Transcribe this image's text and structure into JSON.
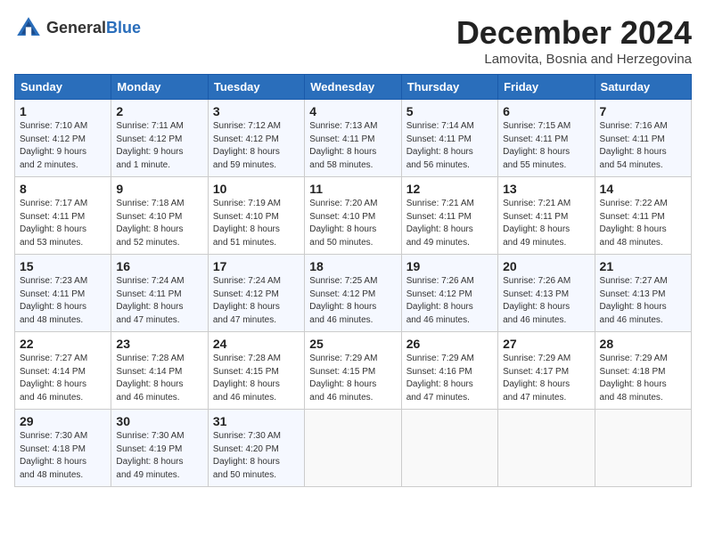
{
  "header": {
    "logo_general": "General",
    "logo_blue": "Blue",
    "title": "December 2024",
    "subtitle": "Lamovita, Bosnia and Herzegovina"
  },
  "columns": [
    "Sunday",
    "Monday",
    "Tuesday",
    "Wednesday",
    "Thursday",
    "Friday",
    "Saturday"
  ],
  "rows": [
    [
      {
        "day": "1",
        "lines": [
          "Sunrise: 7:10 AM",
          "Sunset: 4:12 PM",
          "Daylight: 9 hours",
          "and 2 minutes."
        ]
      },
      {
        "day": "2",
        "lines": [
          "Sunrise: 7:11 AM",
          "Sunset: 4:12 PM",
          "Daylight: 9 hours",
          "and 1 minute."
        ]
      },
      {
        "day": "3",
        "lines": [
          "Sunrise: 7:12 AM",
          "Sunset: 4:12 PM",
          "Daylight: 8 hours",
          "and 59 minutes."
        ]
      },
      {
        "day": "4",
        "lines": [
          "Sunrise: 7:13 AM",
          "Sunset: 4:11 PM",
          "Daylight: 8 hours",
          "and 58 minutes."
        ]
      },
      {
        "day": "5",
        "lines": [
          "Sunrise: 7:14 AM",
          "Sunset: 4:11 PM",
          "Daylight: 8 hours",
          "and 56 minutes."
        ]
      },
      {
        "day": "6",
        "lines": [
          "Sunrise: 7:15 AM",
          "Sunset: 4:11 PM",
          "Daylight: 8 hours",
          "and 55 minutes."
        ]
      },
      {
        "day": "7",
        "lines": [
          "Sunrise: 7:16 AM",
          "Sunset: 4:11 PM",
          "Daylight: 8 hours",
          "and 54 minutes."
        ]
      }
    ],
    [
      {
        "day": "8",
        "lines": [
          "Sunrise: 7:17 AM",
          "Sunset: 4:11 PM",
          "Daylight: 8 hours",
          "and 53 minutes."
        ]
      },
      {
        "day": "9",
        "lines": [
          "Sunrise: 7:18 AM",
          "Sunset: 4:10 PM",
          "Daylight: 8 hours",
          "and 52 minutes."
        ]
      },
      {
        "day": "10",
        "lines": [
          "Sunrise: 7:19 AM",
          "Sunset: 4:10 PM",
          "Daylight: 8 hours",
          "and 51 minutes."
        ]
      },
      {
        "day": "11",
        "lines": [
          "Sunrise: 7:20 AM",
          "Sunset: 4:10 PM",
          "Daylight: 8 hours",
          "and 50 minutes."
        ]
      },
      {
        "day": "12",
        "lines": [
          "Sunrise: 7:21 AM",
          "Sunset: 4:11 PM",
          "Daylight: 8 hours",
          "and 49 minutes."
        ]
      },
      {
        "day": "13",
        "lines": [
          "Sunrise: 7:21 AM",
          "Sunset: 4:11 PM",
          "Daylight: 8 hours",
          "and 49 minutes."
        ]
      },
      {
        "day": "14",
        "lines": [
          "Sunrise: 7:22 AM",
          "Sunset: 4:11 PM",
          "Daylight: 8 hours",
          "and 48 minutes."
        ]
      }
    ],
    [
      {
        "day": "15",
        "lines": [
          "Sunrise: 7:23 AM",
          "Sunset: 4:11 PM",
          "Daylight: 8 hours",
          "and 48 minutes."
        ]
      },
      {
        "day": "16",
        "lines": [
          "Sunrise: 7:24 AM",
          "Sunset: 4:11 PM",
          "Daylight: 8 hours",
          "and 47 minutes."
        ]
      },
      {
        "day": "17",
        "lines": [
          "Sunrise: 7:24 AM",
          "Sunset: 4:12 PM",
          "Daylight: 8 hours",
          "and 47 minutes."
        ]
      },
      {
        "day": "18",
        "lines": [
          "Sunrise: 7:25 AM",
          "Sunset: 4:12 PM",
          "Daylight: 8 hours",
          "and 46 minutes."
        ]
      },
      {
        "day": "19",
        "lines": [
          "Sunrise: 7:26 AM",
          "Sunset: 4:12 PM",
          "Daylight: 8 hours",
          "and 46 minutes."
        ]
      },
      {
        "day": "20",
        "lines": [
          "Sunrise: 7:26 AM",
          "Sunset: 4:13 PM",
          "Daylight: 8 hours",
          "and 46 minutes."
        ]
      },
      {
        "day": "21",
        "lines": [
          "Sunrise: 7:27 AM",
          "Sunset: 4:13 PM",
          "Daylight: 8 hours",
          "and 46 minutes."
        ]
      }
    ],
    [
      {
        "day": "22",
        "lines": [
          "Sunrise: 7:27 AM",
          "Sunset: 4:14 PM",
          "Daylight: 8 hours",
          "and 46 minutes."
        ]
      },
      {
        "day": "23",
        "lines": [
          "Sunrise: 7:28 AM",
          "Sunset: 4:14 PM",
          "Daylight: 8 hours",
          "and 46 minutes."
        ]
      },
      {
        "day": "24",
        "lines": [
          "Sunrise: 7:28 AM",
          "Sunset: 4:15 PM",
          "Daylight: 8 hours",
          "and 46 minutes."
        ]
      },
      {
        "day": "25",
        "lines": [
          "Sunrise: 7:29 AM",
          "Sunset: 4:15 PM",
          "Daylight: 8 hours",
          "and 46 minutes."
        ]
      },
      {
        "day": "26",
        "lines": [
          "Sunrise: 7:29 AM",
          "Sunset: 4:16 PM",
          "Daylight: 8 hours",
          "and 47 minutes."
        ]
      },
      {
        "day": "27",
        "lines": [
          "Sunrise: 7:29 AM",
          "Sunset: 4:17 PM",
          "Daylight: 8 hours",
          "and 47 minutes."
        ]
      },
      {
        "day": "28",
        "lines": [
          "Sunrise: 7:29 AM",
          "Sunset: 4:18 PM",
          "Daylight: 8 hours",
          "and 48 minutes."
        ]
      }
    ],
    [
      {
        "day": "29",
        "lines": [
          "Sunrise: 7:30 AM",
          "Sunset: 4:18 PM",
          "Daylight: 8 hours",
          "and 48 minutes."
        ]
      },
      {
        "day": "30",
        "lines": [
          "Sunrise: 7:30 AM",
          "Sunset: 4:19 PM",
          "Daylight: 8 hours",
          "and 49 minutes."
        ]
      },
      {
        "day": "31",
        "lines": [
          "Sunrise: 7:30 AM",
          "Sunset: 4:20 PM",
          "Daylight: 8 hours",
          "and 50 minutes."
        ]
      },
      null,
      null,
      null,
      null
    ]
  ]
}
